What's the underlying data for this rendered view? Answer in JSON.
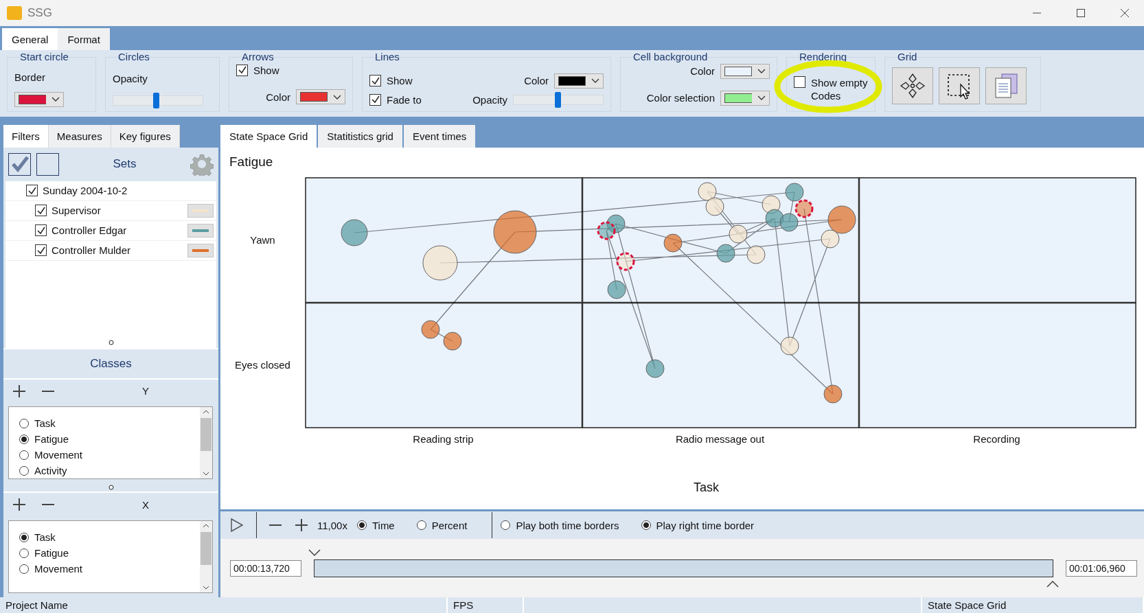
{
  "window": {
    "title": "SSG"
  },
  "ribbon_tabs": [
    {
      "label": "General",
      "selected": true
    },
    {
      "label": "Format",
      "selected": false
    }
  ],
  "ribbon": {
    "start_circle": {
      "title": "Start circle",
      "border": {
        "label": "Border",
        "color": "#dc143c"
      }
    },
    "circles": {
      "title": "Circles",
      "opacity_label": "Opacity",
      "opacity": {
        "level": 0.48
      }
    },
    "arrows": {
      "title": "Arrows",
      "show": {
        "label": "Show",
        "checked": true
      },
      "color_label": "Color",
      "color": "#e83232"
    },
    "lines": {
      "title": "Lines",
      "show": {
        "label": "Show",
        "checked": true
      },
      "fade": {
        "label": "Fade to",
        "checked": true
      },
      "color_label": "Color",
      "color": "#000000",
      "opacity_label": "Opacity",
      "opacity": {
        "level": 0.49
      }
    },
    "cell_background": {
      "title": "Cell background",
      "color_label": "Color",
      "color": "#eaf2fc",
      "selection": {
        "label": "Color selection",
        "color": "#90ee90"
      }
    },
    "rendering": {
      "title": "Rendering",
      "show_empty": {
        "label": "Show empty Codes",
        "checked": false
      }
    },
    "grid": {
      "title": "Grid"
    }
  },
  "left_tabs": [
    {
      "label": "Filters",
      "selected": true
    },
    {
      "label": "Measures",
      "selected": false
    },
    {
      "label": "Key figures",
      "selected": false
    }
  ],
  "sets": {
    "title": "Sets",
    "items": [
      {
        "label": "Sunday 2004-10-2",
        "checked": true,
        "children": [
          {
            "label": "Supervisor",
            "checked": true,
            "color": "#f5e4cc"
          },
          {
            "label": "Controller Edgar",
            "checked": true,
            "color": "#5a9ea3"
          },
          {
            "label": "Controller Mulder",
            "checked": true,
            "color": "#e0702a"
          }
        ]
      }
    ]
  },
  "classes": {
    "title": "Classes",
    "y": {
      "label": "Y",
      "options": [
        {
          "label": "Task",
          "selected": false
        },
        {
          "label": "Fatigue",
          "selected": true
        },
        {
          "label": "Movement",
          "selected": false
        },
        {
          "label": "Activity",
          "selected": false
        }
      ]
    },
    "x": {
      "label": "X",
      "options": [
        {
          "label": "Task",
          "selected": true
        },
        {
          "label": "Fatigue",
          "selected": false
        },
        {
          "label": "Movement",
          "selected": false
        }
      ]
    }
  },
  "main_tabs": [
    {
      "label": "State Space Grid",
      "selected": true
    },
    {
      "label": "Statitistics grid",
      "selected": false
    },
    {
      "label": "Event times",
      "selected": false
    }
  ],
  "grid_view": {
    "title": "Fatigue",
    "rows": [
      "Yawn",
      "Eyes closed"
    ],
    "columns": [
      "Reading strip",
      "Radio message out",
      "Recording"
    ],
    "x_axis_title": "Task"
  },
  "player": {
    "speed": "11,00x",
    "modes": [
      {
        "label": "Time",
        "selected": true
      },
      {
        "label": "Percent",
        "selected": false
      }
    ],
    "borders": [
      {
        "label": "Play both time borders",
        "selected": false
      },
      {
        "label": "Play right time border",
        "selected": true
      }
    ],
    "start": "00:00:13,720",
    "end": "00:01:06,960"
  },
  "status_bar": {
    "project": "Project Name",
    "fps": "FPS",
    "view": "State Space Grid"
  }
}
